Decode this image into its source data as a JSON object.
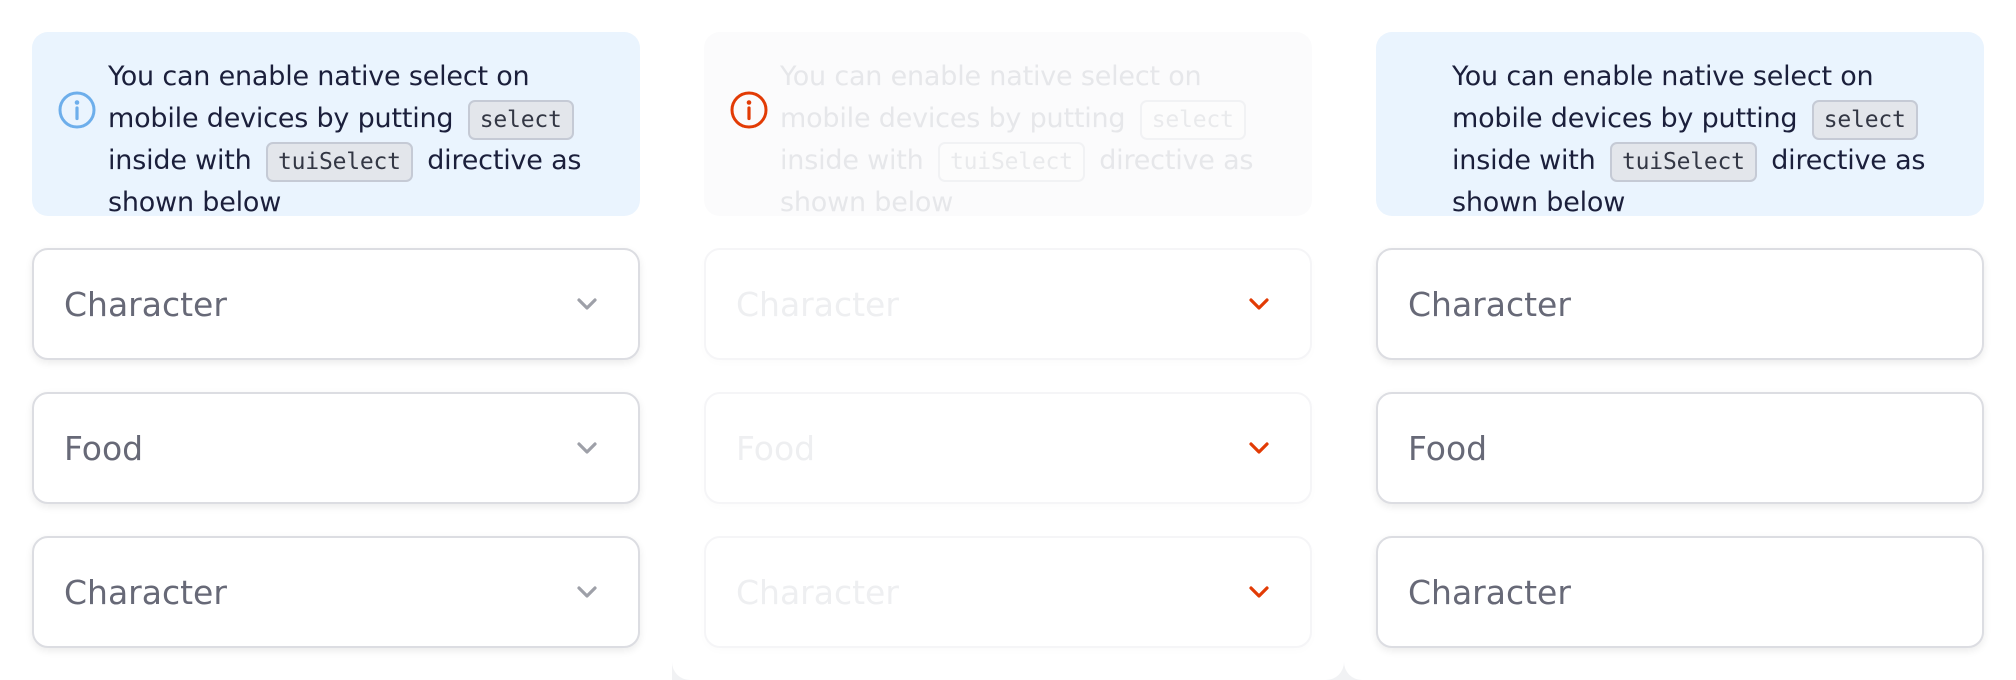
{
  "colors": {
    "notice_background": "#eaf4fe",
    "info_icon": "#6daeeb",
    "warning_icon": "#e23b05",
    "chevron_default": "#9ea0a8",
    "chevron_error": "#e23b05",
    "field_border": "#dcdde2",
    "placeholder_text": "#676977"
  },
  "icons": {
    "info": "info-circle-icon",
    "warning": "warning-circle-icon",
    "chevron": "chevron-down-icon"
  },
  "notice": {
    "text_part_1": "You can enable native select on mobile devices by putting",
    "code_1": "select",
    "text_part_2": "inside with",
    "code_2": "tuiSelect",
    "text_part_3": "directive as shown below"
  },
  "panels": [
    {
      "variant": "default",
      "selects": [
        {
          "value": "Character"
        },
        {
          "value": "Food"
        },
        {
          "value": "Character"
        }
      ]
    },
    {
      "variant": "disabled",
      "selects": [
        {
          "value": "Character"
        },
        {
          "value": "Food"
        },
        {
          "value": "Character"
        }
      ]
    },
    {
      "variant": "native",
      "selects": [
        {
          "value": "Character"
        },
        {
          "value": "Food"
        },
        {
          "value": "Character"
        }
      ]
    }
  ]
}
